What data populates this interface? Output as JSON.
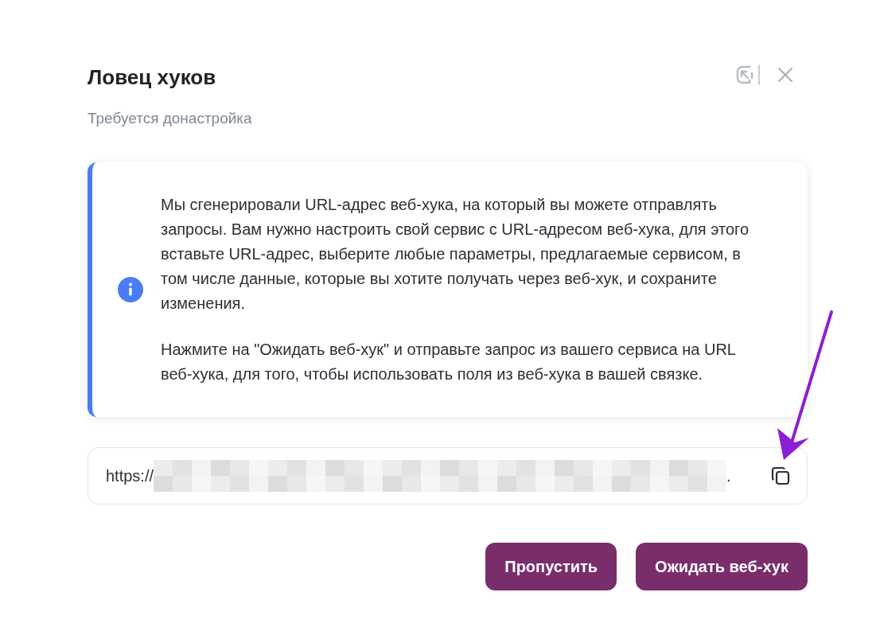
{
  "dialog": {
    "title": "Ловец хуков",
    "subtitle": "Требуется донастройка"
  },
  "info": {
    "paragraphs": [
      "Мы сгенерировали URL-адрес веб-хука, на который вы можете отправлять запросы. Вам нужно настроить свой сервис с URL-адресом веб-хука, для этого вставьте URL-адрес, выберите любые параметры, предлагаемые сервисом, в том числе данные, которые вы хотите получать через веб-хук, и сохраните изменения.",
      "Нажмите на \"Ожидать веб-хук\" и отправьте запрос из вашего сервиса на URL веб-хука, для того, чтобы использовать поля из веб-хука в вашей связке."
    ]
  },
  "url_field": {
    "prefix": "https://",
    "suffix": "."
  },
  "buttons": [
    "Пропустить",
    "Ожидать веб-хук"
  ]
}
